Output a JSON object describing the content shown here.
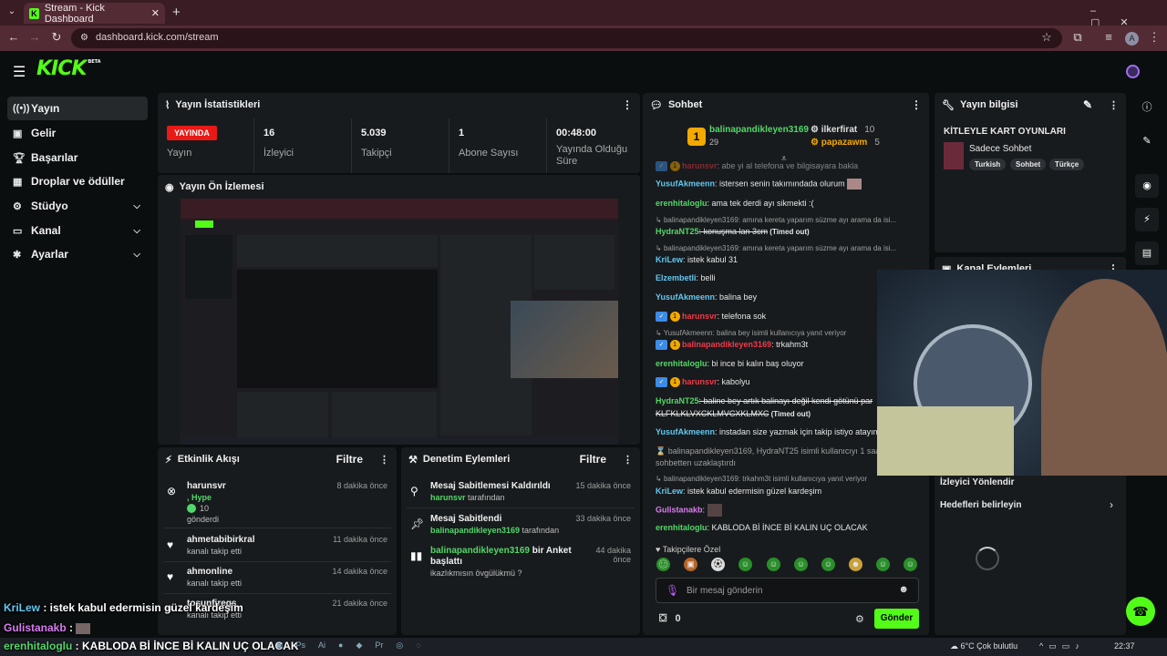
{
  "browser": {
    "tab_title": "Stream - Kick Dashboard",
    "url": "dashboard.kick.com/stream",
    "profile_initial": "A"
  },
  "header": {
    "logo": "KICK",
    "logo_beta": "BETA"
  },
  "sidebar": {
    "items": [
      {
        "label": "Yayın",
        "icon": "broadcast-icon"
      },
      {
        "label": "Gelir",
        "icon": "dollar-icon"
      },
      {
        "label": "Başarılar",
        "icon": "trophy-icon"
      },
      {
        "label": "Droplar ve ödüller",
        "icon": "gift-icon"
      },
      {
        "label": "Stüdyo",
        "icon": "gear-icon"
      },
      {
        "label": "Kanal",
        "icon": "tv-icon"
      },
      {
        "label": "Ayarlar",
        "icon": "settings-icon"
      }
    ]
  },
  "stats": {
    "title": "Yayın İstatistikleri",
    "live_badge": "YAYINDA",
    "live_label": "Yayın",
    "viewers": "16",
    "viewers_label": "İzleyici",
    "followers": "5.039",
    "followers_label": "Takipçi",
    "subs": "1",
    "subs_label": "Abone Sayısı",
    "duration": "00:48:00",
    "duration_label": "Yayında Olduğu Süre"
  },
  "preview": {
    "title": "Yayın Ön İzlemesi"
  },
  "activity": {
    "title": "Etkinlik Akışı",
    "filter": "Filtre",
    "items": [
      {
        "name": "harunsvr",
        "l2": ", Hype",
        "l3": "10",
        "l4": "gönderdi",
        "time": "8 dakika önce"
      },
      {
        "name": "ahmetabibirkral",
        "l2": "kanalı takip etti",
        "time": "11 dakika önce"
      },
      {
        "name": "ahmonline",
        "l2": "kanalı takip etti",
        "time": "14 dakika önce"
      },
      {
        "name": "tosunfireqs",
        "l2": "kanalı takip etti",
        "time": "21 dakika önce"
      }
    ]
  },
  "moderation": {
    "title": "Denetim Eylemleri",
    "filter": "Filtre",
    "items": [
      {
        "title": "Mesaj Sabitlemesi Kaldırıldı",
        "user": "harunsvr",
        "suffix": " tarafından",
        "time": "15 dakika önce"
      },
      {
        "title": "Mesaj Sabitlendi",
        "user": "balinapandikleyen3169",
        "suffix": " tarafından",
        "time": "33 dakika önce"
      },
      {
        "title_user": "balinapandikleyen3169",
        "title_rest": " bir Anket başlattı",
        "sub": "ikazlıkmısın övgülükmü ?",
        "time": "44 dakika önce"
      }
    ]
  },
  "chat": {
    "title": "Sohbet",
    "top1_rank": "1",
    "top1_name": "balinapandikleyen3169",
    "top1_count": "29",
    "top2_name": "ilkerfirat",
    "top2_count": "10",
    "top3_name": "papazawm",
    "top3_count": "5",
    "lines": [
      {
        "user": "harunsvr",
        "text": ": abe yi al telefona ve bilgisayara bakla"
      },
      {
        "user": "YusufAkmeenn",
        "text": ": istersen senin takımındada olurum"
      },
      {
        "user": "erenhitaloglu",
        "text": ": ama tek derdi ayı sikmekti :("
      },
      {
        "reply": "balinapandikleyen3169: amına kereta yaparım süzme ayı arama da isi..."
      },
      {
        "user": "HydraNT25",
        "text": ": konuşma lan 3cm",
        "extra": " (Timed out)"
      },
      {
        "reply": "balinapandikleyen3169: amına kereta yaparım süzme ayı arama da isi..."
      },
      {
        "user": "KriLew",
        "text": ": istek kabul 31"
      },
      {
        "user": "Elzembetli",
        "text": ": belli"
      },
      {
        "user": "YusufAkmeenn",
        "text": ": balina bey"
      },
      {
        "user": "harunsvr",
        "text": ": telefona sok"
      },
      {
        "reply": "YusufAkmeenn: balina bey isimli kullanıcıya yanıt veriyor"
      },
      {
        "user": "balinapandikleyen3169",
        "text": ": trkahm3t"
      },
      {
        "user": "erenhitaloglu",
        "text": ": bi ince bi kalın baş oluyor"
      },
      {
        "user": "harunsvr",
        "text": ": kabolyu"
      },
      {
        "user": "HydraNT25",
        "text": ": baline bey artık balinayı değil kendi götünü par"
      },
      {
        "text": "KLFKLKLVXCKLMVCXKLMXC",
        "extra": " (Timed out)"
      },
      {
        "user": "YusufAkmeenn",
        "text": ": instadan size yazmak için takip istiyo atayım"
      },
      {
        "system": "balinapandikleyen3169, HydraNT25 isimli kullanıcıyı 1 saat sü sohbetten uzaklaştırdı"
      },
      {
        "reply": "balinapandikleyen3169: trkahm3t isimli kullanıcıya yanıt veriyor"
      },
      {
        "user": "KriLew",
        "text": ": istek kabul edermisin güzel kardeşim"
      },
      {
        "user": "Gulistanakb",
        "text": ":"
      },
      {
        "user": "erenhitaloglu",
        "text": ": KABLODA Bİ İNCE Bİ KALIN UÇ OLACAK"
      }
    ],
    "followers_only": "Takipçilere Özel",
    "placeholder": "Bir mesaj gönderin",
    "count": "0",
    "send": "Gönder"
  },
  "stream_info": {
    "title": "Yayın bilgisi",
    "stream_title": "KİTLEYLE KART OYUNLARI",
    "category": "Sadece Sohbet",
    "tags": [
      "Turkish",
      "Sohbet",
      "Türkçe"
    ]
  },
  "channel_actions": {
    "title": "Kanal Eylemleri",
    "redirect": "İzleyici Yönlendir",
    "goals": "Hedefleri belirleyin"
  },
  "overlay": {
    "line1_user": "KriLew",
    "line1_text": " : istek kabul edermisin güzel kardeşim",
    "line2_user": "Gulistanakb",
    "line2_text": " :",
    "line3_user": "erenhitaloglu",
    "line3_text": " : KABLODA Bİ İNCE Bİ KALIN UÇ OLACAK"
  },
  "taskbar": {
    "weather": "6°C  Çok bulutlu",
    "time": "22:37"
  },
  "colors": {
    "accent": "#53fc18",
    "live": "#e91916",
    "panel": "#181b1d",
    "background": "#0b0e0f",
    "tab_bar": "#3a1c24"
  }
}
